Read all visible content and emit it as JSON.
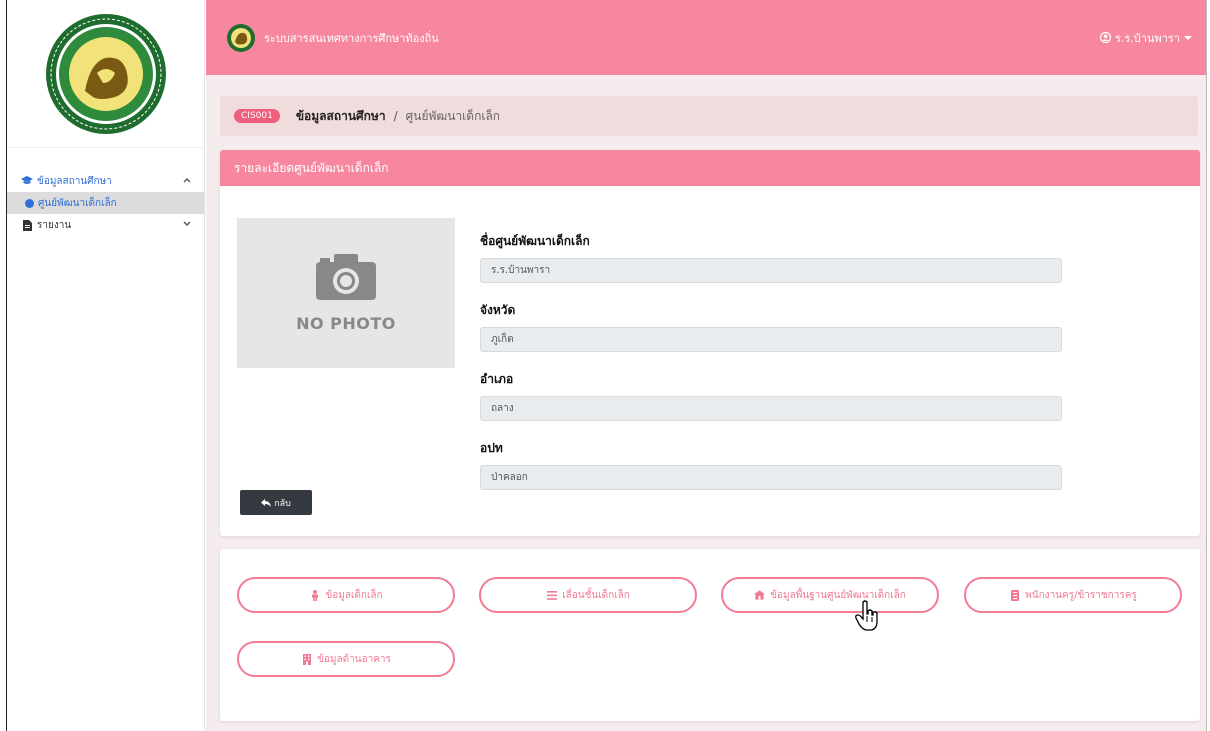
{
  "sidebar": {
    "items": [
      {
        "label": "ข้อมูลสถานศึกษา",
        "icon": "graduation-cap-icon",
        "open": true,
        "children": [
          {
            "label": "ศูนย์พัฒนาเด็กเล็ก",
            "active": true
          }
        ]
      },
      {
        "label": "รายงาน",
        "icon": "document-icon",
        "open": false
      }
    ]
  },
  "topbar": {
    "brand": "ระบบสารสนเทศทางการศึกษาท้องถิ่น",
    "user": "ร.ร.บ้านพารา"
  },
  "breadcrumb": {
    "code": "CIS001",
    "section": "ข้อมูลสถานศึกษา",
    "separator": "/",
    "page": "ศูนย์พัฒนาเด็กเล็ก"
  },
  "detail": {
    "title": "รายละเอียดศูนย์พัฒนาเด็กเล็ก",
    "photo_placeholder": "NO PHOTO",
    "fields": [
      {
        "label": "ชื่อศูนย์พัฒนาเด็กเล็ก",
        "value": "ร.ร.บ้านพารา"
      },
      {
        "label": "จังหวัด",
        "value": "ภูเก็ต"
      },
      {
        "label": "อำเภอ",
        "value": "ถลาง"
      },
      {
        "label": "อปท",
        "value": "ป่าคลอก"
      }
    ],
    "back_label": "กลับ"
  },
  "actions": [
    {
      "label": "ข้อมูลเด็กเล็ก",
      "icon": "child-icon"
    },
    {
      "label": "เลื่อนชั้นเด็กเล็ก",
      "icon": "list-icon"
    },
    {
      "label": "ข้อมูลพื้นฐานศูนย์พัฒนาเด็กเล็ก",
      "icon": "building-icon"
    },
    {
      "label": "พนักงานครู/ข้าราชการครู",
      "icon": "id-badge-icon"
    },
    {
      "label": "ข้อมูลด้านอาคาร",
      "icon": "building-icon"
    }
  ],
  "colors": {
    "primary": "#f7879f",
    "accent": "#f07a92",
    "link": "#2f6fd6"
  }
}
